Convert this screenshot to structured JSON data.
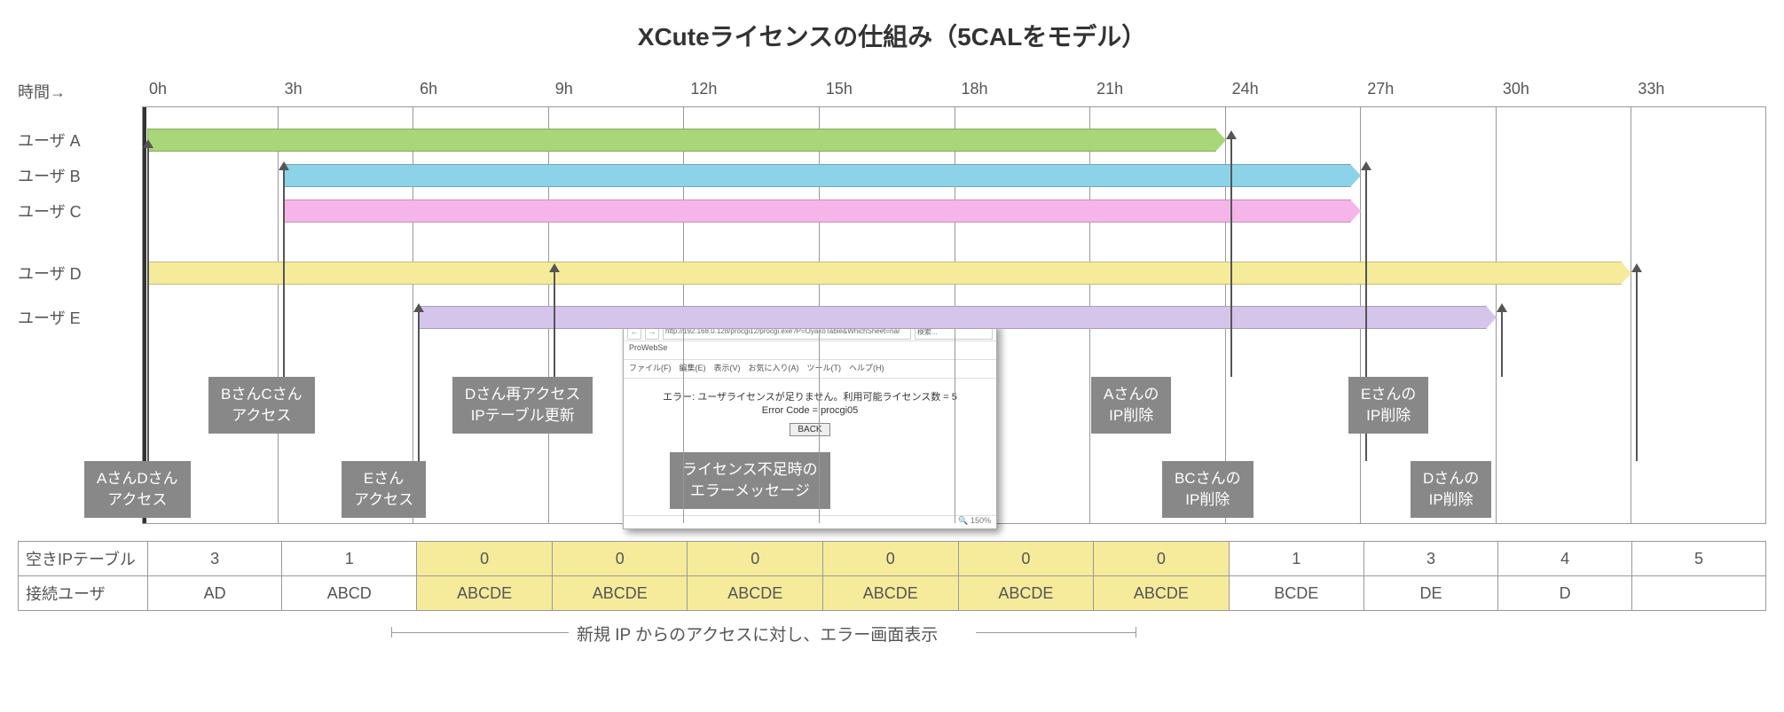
{
  "title": "XCuteライセンスの仕組み（5CALをモデル）",
  "timeAxisLabel": "時間→",
  "hours": [
    "0h",
    "3h",
    "6h",
    "9h",
    "12h",
    "15h",
    "18h",
    "21h",
    "24h",
    "27h",
    "30h",
    "33h"
  ],
  "users": [
    "ユーザ A",
    "ユーザ B",
    "ユーザ C",
    "ユーザ D",
    "ユーザ E"
  ],
  "callouts": {
    "c1": {
      "l1": "AさんDさん",
      "l2": "アクセス"
    },
    "c2": {
      "l1": "BさんCさん",
      "l2": "アクセス"
    },
    "c3": {
      "l1": "Eさん",
      "l2": "アクセス"
    },
    "c4": {
      "l1": "Dさん再アクセス",
      "l2": "IPテーブル更新"
    },
    "c5": {
      "l1": "Aさんの",
      "l2": "IP削除"
    },
    "c6": {
      "l1": "BCさんの",
      "l2": "IP削除"
    },
    "c7": {
      "l1": "Eさんの",
      "l2": "IP削除"
    },
    "c8": {
      "l1": "Dさんの",
      "l2": "IP削除"
    }
  },
  "errorWindow": {
    "url": "http://192.168.0.128/procgi12/procgi.exe?P=OyakoTable&WhichSheet=nar",
    "search": "検索...",
    "tab": "ProWebSe",
    "menu": "ファイル(F)　編集(E)　表示(V)　お気に入り(A)　ツール(T)　ヘルプ(H)",
    "msg1": "エラー: ユーザライセンスが足りません。利用可能ライセンス数 = 5",
    "msg2": "Error Code = procgi05",
    "back": "BACK",
    "zoom": "🔍 150%"
  },
  "errorCaption": {
    "l1": "ライセンス不足時の",
    "l2": "エラーメッセージ"
  },
  "tableHeaders": {
    "row1": "空きIPテーブル",
    "row2": "接続ユーザ"
  },
  "tableRow1": [
    "3",
    "1",
    "0",
    "0",
    "0",
    "0",
    "0",
    "0",
    "1",
    "3",
    "4",
    "5"
  ],
  "tableRow1Hl": [
    false,
    false,
    true,
    true,
    true,
    true,
    true,
    true,
    false,
    false,
    false,
    false
  ],
  "tableRow2": [
    "AD",
    "ABCD",
    "ABCDE",
    "ABCDE",
    "ABCDE",
    "ABCDE",
    "ABCDE",
    "ABCDE",
    "BCDE",
    "DE",
    "D",
    ""
  ],
  "tableRow2Hl": [
    false,
    false,
    true,
    true,
    true,
    true,
    true,
    true,
    false,
    false,
    false,
    false
  ],
  "footerNote": "新規 IP からのアクセスに対し、エラー画面表示",
  "chart_data": {
    "type": "gantt",
    "title": "XCuteライセンスの仕組み（5CALをモデル）",
    "xlabel": "時間→",
    "x_ticks": [
      0,
      3,
      6,
      9,
      12,
      15,
      18,
      21,
      24,
      27,
      30,
      33
    ],
    "series": [
      {
        "name": "ユーザ A",
        "start": 0,
        "end": 24,
        "color": "#a8d678"
      },
      {
        "name": "ユーザ B",
        "start": 3,
        "end": 27,
        "color": "#8dd3e8"
      },
      {
        "name": "ユーザ C",
        "start": 3,
        "end": 27,
        "color": "#f5b5e8"
      },
      {
        "name": "ユーザ D",
        "start": 0,
        "end": 33,
        "color": "#f5eb9b"
      },
      {
        "name": "ユーザ E",
        "start": 6,
        "end": 30,
        "color": "#d5c5ea"
      }
    ],
    "events": [
      {
        "hour": 0,
        "label": "AさんDさんアクセス"
      },
      {
        "hour": 3,
        "label": "BさんCさんアクセス"
      },
      {
        "hour": 6,
        "label": "Eさんアクセス"
      },
      {
        "hour": 9,
        "label": "Dさん再アクセス IPテーブル更新"
      },
      {
        "hour": 24,
        "label": "AさんのIP削除"
      },
      {
        "hour": 27,
        "label": "BCさんのIP削除"
      },
      {
        "hour": 30,
        "label": "EさんのIP削除"
      },
      {
        "hour": 33,
        "label": "DさんのIP削除"
      }
    ],
    "free_ip_slots": {
      "0h": 3,
      "3h": 1,
      "6h": 0,
      "9h": 0,
      "12h": 0,
      "15h": 0,
      "18h": 0,
      "21h": 0,
      "24h": 1,
      "27h": 3,
      "30h": 4,
      "33h": 5
    },
    "connected_users": {
      "0h": "AD",
      "3h": "ABCD",
      "6h": "ABCDE",
      "9h": "ABCDE",
      "12h": "ABCDE",
      "15h": "ABCDE",
      "18h": "ABCDE",
      "21h": "ABCDE",
      "24h": "BCDE",
      "27h": "DE",
      "30h": "D",
      "33h": ""
    },
    "full_range_note": "6h-24h: 新規IPからのアクセスに対し、エラー画面表示"
  }
}
